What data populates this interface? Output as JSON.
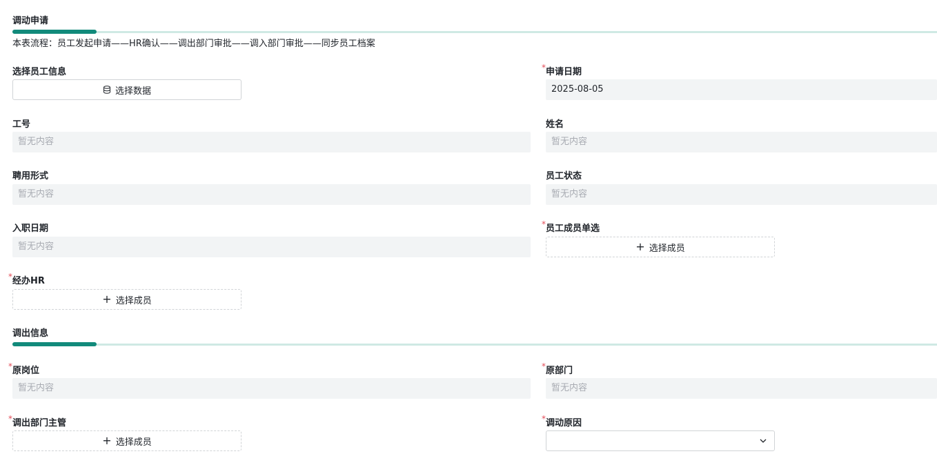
{
  "section1": {
    "title": "调动申请",
    "description": "本表流程：员工发起申请——HR确认——调出部门审批——调入部门审批——同步员工档案"
  },
  "fields": {
    "select_employee": {
      "label": "选择员工信息",
      "button": "选择数据"
    },
    "apply_date": {
      "label": "申请日期",
      "value": "2025-08-05"
    },
    "employee_no": {
      "label": "工号",
      "placeholder": "暂无内容"
    },
    "name": {
      "label": "姓名",
      "placeholder": "暂无内容"
    },
    "employment_type": {
      "label": "聘用形式",
      "placeholder": "暂无内容"
    },
    "employee_status": {
      "label": "员工状态",
      "placeholder": "暂无内容"
    },
    "hire_date": {
      "label": "入职日期",
      "placeholder": "暂无内容"
    },
    "member_single": {
      "label": "员工成员单选",
      "button": "选择成员"
    },
    "handling_hr": {
      "label": "经办HR",
      "button": "选择成员"
    }
  },
  "section2": {
    "title": "调出信息"
  },
  "transfer_out": {
    "original_position": {
      "label": "原岗位",
      "placeholder": "暂无内容"
    },
    "original_department": {
      "label": "原部门",
      "placeholder": "暂无内容"
    },
    "out_manager": {
      "label": "调出部门主管",
      "button": "选择成员"
    },
    "transfer_reason": {
      "label": "调动原因",
      "value": ""
    }
  },
  "required_mark": "*",
  "colors": {
    "accent": "#128a7b",
    "rule": "#cfe9e4",
    "required": "#e34d59"
  },
  "icons": {
    "data_button": "database-icon",
    "member_button": "plus-icon",
    "select": "chevron-down-icon"
  }
}
